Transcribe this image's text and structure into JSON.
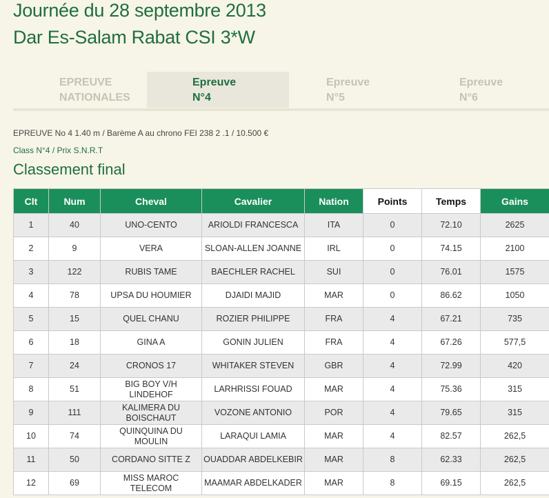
{
  "header": {
    "title": "Journée du 28 septembre 2013",
    "subtitle": "Dar Es-Salam Rabat CSI 3*W"
  },
  "tabs": [
    {
      "line1": "EPREUVE",
      "line2": "NATIONALES"
    },
    {
      "line1": "Epreuve",
      "line2": "N°4"
    },
    {
      "line1": "Epreuve",
      "line2": "N°5"
    },
    {
      "line1": "Epreuve",
      "line2": "N°6"
    }
  ],
  "active_tab": "Epreuve N°4",
  "event_info": "EPREUVE No 4 1.40 m / Barème A au chrono FEI 238 2 .1 / 10.500 €",
  "class_info": "Class N°4 / Prix S.N.R.T",
  "section_title": "Classement final",
  "colors": {
    "accent": "#1a8f5b",
    "title": "#1f6e3f",
    "background": "#f7f5e7"
  },
  "table": {
    "headers": [
      "Clt",
      "Num",
      "Cheval",
      "Cavalier",
      "Nation",
      "Points",
      "Temps",
      "Gains"
    ],
    "rows": [
      [
        "1",
        "40",
        "UNO-CENTO",
        "ARIOLDI FRANCESCA",
        "ITA",
        "0",
        "72.10",
        "2625"
      ],
      [
        "2",
        "9",
        "VERA",
        "SLOAN-ALLEN JOANNE",
        "IRL",
        "0",
        "74.15",
        "2100"
      ],
      [
        "3",
        "122",
        "RUBIS TAME",
        "BAECHLER RACHEL",
        "SUI",
        "0",
        "76.01",
        "1575"
      ],
      [
        "4",
        "78",
        "UPSA DU HOUMIER",
        "DJAIDI MAJID",
        "MAR",
        "0",
        "86.62",
        "1050"
      ],
      [
        "5",
        "15",
        "QUEL CHANU",
        "ROZIER PHILIPPE",
        "FRA",
        "4",
        "67.21",
        "735"
      ],
      [
        "6",
        "18",
        "GINA A",
        "GONIN JULIEN",
        "FRA",
        "4",
        "67.26",
        "577,5"
      ],
      [
        "7",
        "24",
        "CRONOS 17",
        "WHITAKER STEVEN",
        "GBR",
        "4",
        "72.99",
        "420"
      ],
      [
        "8",
        "51",
        "BIG BOY V/H LINDEHOF",
        "LARHRISSI FOUAD",
        "MAR",
        "4",
        "75.36",
        "315"
      ],
      [
        "9",
        "111",
        "KALIMERA DU BOISCHAUT",
        "VOZONE ANTONIO",
        "POR",
        "4",
        "79.65",
        "315"
      ],
      [
        "10",
        "74",
        "QUINQUINA DU MOULIN",
        "LARAQUI LAMIA",
        "MAR",
        "4",
        "82.57",
        "262,5"
      ],
      [
        "11",
        "50",
        "CORDANO SITTE Z",
        "OUADDAR ABDELKEBIR",
        "MAR",
        "8",
        "62.33",
        "262,5"
      ],
      [
        "12",
        "69",
        "MISS MAROC TELECOM",
        "MAAMAR ABDELKADER",
        "MAR",
        "8",
        "69.15",
        "262,5"
      ]
    ]
  }
}
